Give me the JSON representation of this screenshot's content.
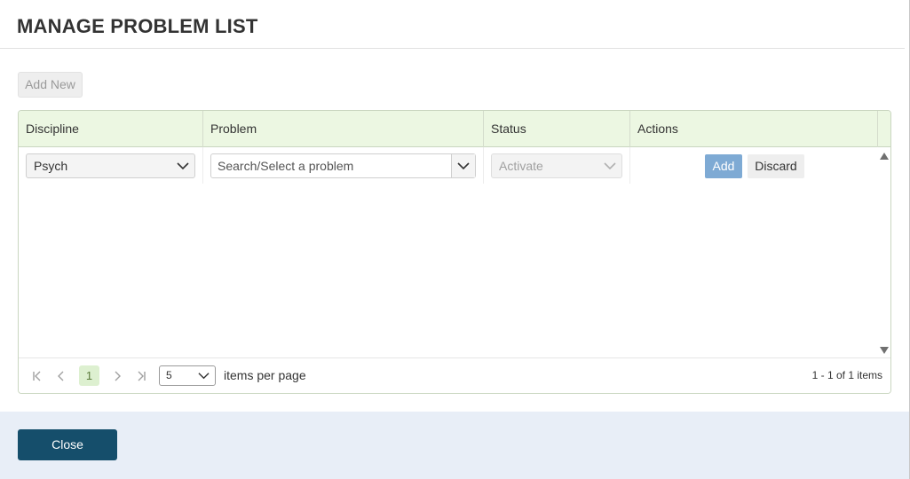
{
  "dialog": {
    "title": "MANAGE PROBLEM LIST",
    "add_new_label": "Add New",
    "close_label": "Close"
  },
  "grid": {
    "columns": [
      "Discipline",
      "Problem",
      "Status",
      "Actions"
    ],
    "edit_row": {
      "discipline_value": "Psych",
      "problem_placeholder": "Search/Select a problem",
      "status_value": "Activate",
      "add_label": "Add",
      "discard_label": "Discard"
    }
  },
  "pager": {
    "first_icon": "first-page-icon",
    "prev_icon": "previous-page-icon",
    "current_page": "1",
    "next_icon": "next-page-icon",
    "last_icon": "last-page-icon",
    "page_size": "5",
    "items_per_page_label": "items per page",
    "info": "1 - 1 of 1 items"
  },
  "colors": {
    "header_bg": "#ecf7e2",
    "add_button": "#7eaad4",
    "close_button": "#154e6b",
    "footer_bg": "#e8eef7"
  }
}
